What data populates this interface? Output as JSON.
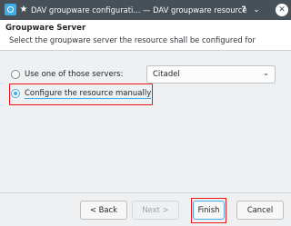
{
  "window": {
    "title": "DAV groupware configurati... — DAV groupware resource",
    "icons": [
      "app-icon",
      "pin-icon",
      "help-icon",
      "minimize-icon",
      "close-icon"
    ]
  },
  "header": {
    "title": "Groupware Server",
    "subtitle": "Select the groupware server the resource shall be configured for"
  },
  "options": {
    "use_server_label": "Use one of those servers:",
    "manual_label": "Configure the resource manually",
    "selected": "manual",
    "server_select_value": "Citadel"
  },
  "buttons": {
    "back": "< Back",
    "next": "Next >",
    "finish": "Finish",
    "cancel": "Cancel"
  },
  "colors": {
    "accent": "#3daee9",
    "highlight": "#ed1515",
    "titlebar": "#475057"
  }
}
